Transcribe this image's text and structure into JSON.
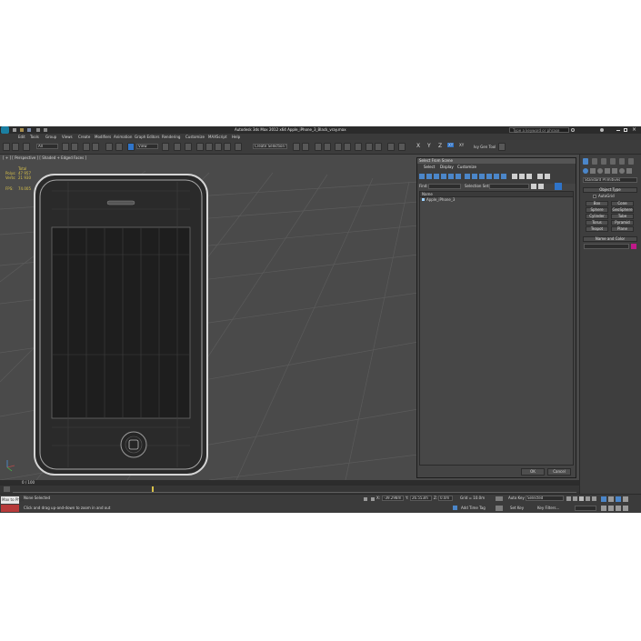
{
  "window": {
    "title": "Autodesk 3ds Max  2012 x64     Apple_iPhone_3_Black_vray.max",
    "search_placeholder": "Type a keyword or phrase"
  },
  "menu": [
    "Edit",
    "Tools",
    "Group",
    "Views",
    "Create",
    "Modifiers",
    "Animation",
    "Graph Editors",
    "Rendering",
    "Customize",
    "MAXScript",
    "Help"
  ],
  "toolbar": {
    "selection_filter": "All",
    "ref_coord": "View",
    "named_selection": "Create Selection Se",
    "axis_labels": [
      "X",
      "Y",
      "Z",
      "XY",
      "XY"
    ],
    "xy_label": "XY",
    "ivy_tools": "Ivy Gen Tool"
  },
  "viewport": {
    "label": "[ + ] [ Perspective ] [ Shaded + Edged Faces ]",
    "stats_title": "Total",
    "polys_label": "Polys:",
    "polys_value": "47 957",
    "verts_label": "Verts:",
    "verts_value": "21 930",
    "fps_label": "FPS:",
    "fps_value": "74.005"
  },
  "dialog": {
    "title": "Select From Scene",
    "tabs": [
      "Select",
      "Display",
      "Customize"
    ],
    "find_label": "Find:",
    "selection_set_label": "Selection Set:",
    "column_name": "Name",
    "items": [
      "Apple_iPhone_3"
    ],
    "ok": "OK",
    "cancel": "Cancel"
  },
  "command_panel": {
    "category": "Standard Primitives",
    "object_type_title": "Object Type",
    "autogrid": "AutoGrid",
    "primitives": [
      "Box",
      "Cone",
      "Sphere",
      "GeoSphere",
      "Cylinder",
      "Tube",
      "Torus",
      "Pyramid",
      "Teapot",
      "Plane"
    ],
    "name_color_title": "Name and Color",
    "object_color": "#c0198a"
  },
  "timeline": {
    "frame": "0 / 100"
  },
  "status": {
    "selection": "None Selected",
    "prompt": "Click and drag up-and-down to zoom in and out",
    "script_label": "Max to Phys",
    "x_label": "X:",
    "x_value": "-39.298m",
    "y_label": "Y:",
    "y_value": "26.553m",
    "z_label": "Z:",
    "z_value": "0.0m",
    "grid": "Grid = 10.0m",
    "auto_key": "Auto Key",
    "selected": "Selected",
    "set_key": "Set Key",
    "key_filters": "Key Filters...",
    "add_time_tag": "Add Time Tag"
  },
  "colors": {
    "accent": "#2f74c9",
    "viewport_bg": "#4a4a4a",
    "stats_text": "#d9c24a",
    "object_color": "#c0198a"
  }
}
